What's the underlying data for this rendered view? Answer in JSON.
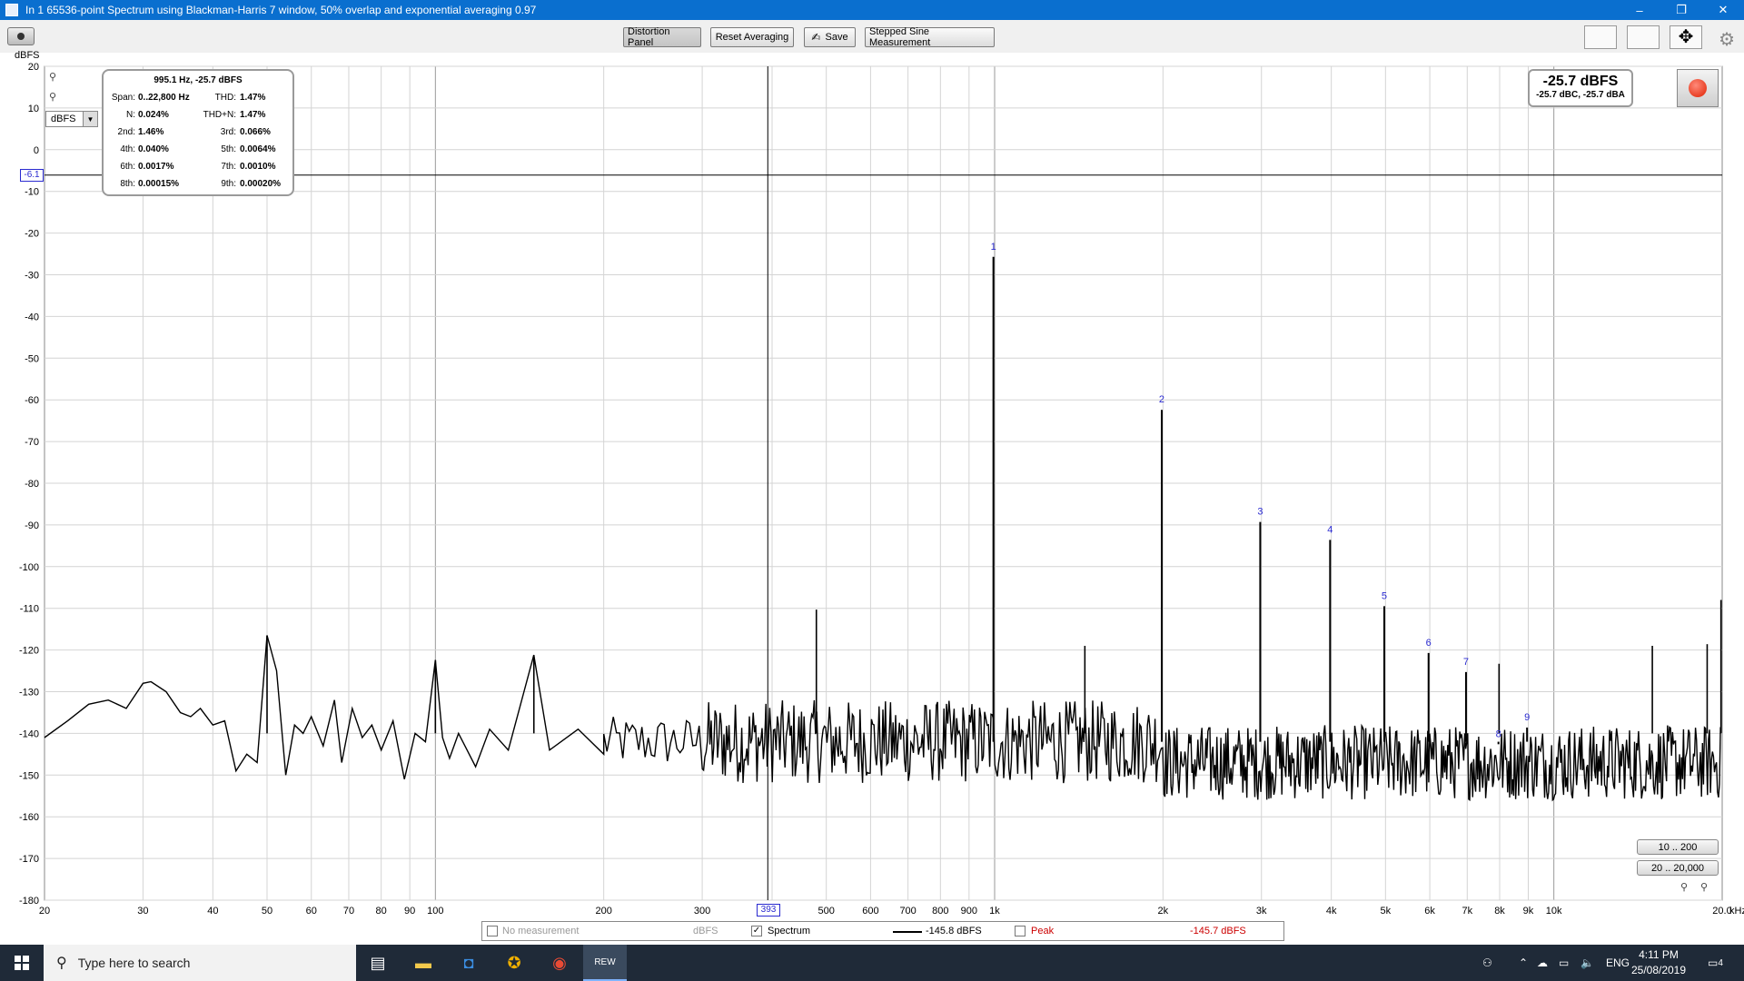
{
  "window": {
    "title": "In 1 65536-point Spectrum using Blackman-Harris 7 window, 50% overlap and exponential averaging 0.97",
    "minimize": "–",
    "restore": "❐",
    "close": "✕"
  },
  "toolbar": {
    "distortion_panel": "Distortion Panel",
    "reset_averaging": "Reset Averaging",
    "save": "Save",
    "stepped_sine": "Stepped Sine Measurement"
  },
  "distortion_panel": {
    "header": "995.1 Hz, -25.7 dBFS",
    "rows": [
      {
        "l1": "Span:",
        "v1": "0..22,800 Hz",
        "l2": "THD:",
        "v2": "1.47%"
      },
      {
        "l1": "N:",
        "v1": "0.024%",
        "l2": "THD+N:",
        "v2": "1.47%"
      },
      {
        "l1": "2nd:",
        "v1": "1.46%",
        "l2": "3rd:",
        "v2": "0.066%"
      },
      {
        "l1": "4th:",
        "v1": "0.040%",
        "l2": "5th:",
        "v2": "0.0064%"
      },
      {
        "l1": "6th:",
        "v1": "0.0017%",
        "l2": "7th:",
        "v2": "0.0010%"
      },
      {
        "l1": "8th:",
        "v1": "0.00015%",
        "l2": "9th:",
        "v2": "0.00020%"
      }
    ]
  },
  "level_meter": {
    "main": "-25.7 dBFS",
    "sub": "-25.7 dBC, -25.7 dBA"
  },
  "unit_select": {
    "value": "dBFS"
  },
  "range_buttons": {
    "a": "10 .. 200",
    "b": "20 .. 20,000"
  },
  "cursor": {
    "y_value": "-6.1",
    "x_value": "393"
  },
  "legend": {
    "no_measurement": "No measurement",
    "no_measurement_unit": "dBFS",
    "spectrum": "Spectrum",
    "spectrum_value": "-145.8 dBFS",
    "peak": "Peak",
    "peak_value": "-145.7 dBFS",
    "peak_color": "#cc0000"
  },
  "taskbar": {
    "search_placeholder": "Type here to search",
    "lang": "ENG",
    "time": "4:11 PM",
    "date": "25/08/2019",
    "notif_count": "4"
  },
  "chart_data": {
    "type": "line",
    "xscale": "log",
    "xlim": [
      20,
      20000
    ],
    "ylim": [
      -180,
      20
    ],
    "ylabel": "dBFS",
    "x_unit_label": "kHz",
    "yticks": [
      20,
      10,
      0,
      -10,
      -20,
      -30,
      -40,
      -50,
      -60,
      -70,
      -80,
      -90,
      -100,
      -110,
      -120,
      -130,
      -140,
      -150,
      -160,
      -170,
      -180
    ],
    "xticks": [
      {
        "v": 20,
        "label": "20"
      },
      {
        "v": 30,
        "label": "30"
      },
      {
        "v": 40,
        "label": "40"
      },
      {
        "v": 50,
        "label": "50"
      },
      {
        "v": 60,
        "label": "60"
      },
      {
        "v": 70,
        "label": "70"
      },
      {
        "v": 80,
        "label": "80"
      },
      {
        "v": 90,
        "label": "90"
      },
      {
        "v": 100,
        "label": "100"
      },
      {
        "v": 200,
        "label": "200"
      },
      {
        "v": 300,
        "label": "300"
      },
      {
        "v": 500,
        "label": "500"
      },
      {
        "v": 600,
        "label": "600"
      },
      {
        "v": 700,
        "label": "700"
      },
      {
        "v": 800,
        "label": "800"
      },
      {
        "v": 900,
        "label": "900"
      },
      {
        "v": 1000,
        "label": "1k"
      },
      {
        "v": 2000,
        "label": "2k"
      },
      {
        "v": 3000,
        "label": "3k"
      },
      {
        "v": 4000,
        "label": "4k"
      },
      {
        "v": 5000,
        "label": "5k"
      },
      {
        "v": 6000,
        "label": "6k"
      },
      {
        "v": 7000,
        "label": "7k"
      },
      {
        "v": 8000,
        "label": "8k"
      },
      {
        "v": 9000,
        "label": "9k"
      },
      {
        "v": 10000,
        "label": "10k"
      },
      {
        "v": 20000,
        "label": "20.0"
      }
    ],
    "cursor_y_db": -6.1,
    "cursor_x_hz": 393,
    "harmonics": [
      {
        "n": "1",
        "f": 995,
        "db": -25.7
      },
      {
        "n": "2",
        "f": 1990,
        "db": -62.4
      },
      {
        "n": "3",
        "f": 2985,
        "db": -89.3
      },
      {
        "n": "4",
        "f": 3980,
        "db": -93.6
      },
      {
        "n": "5",
        "f": 4975,
        "db": -109.5
      },
      {
        "n": "6",
        "f": 5970,
        "db": -120.7
      },
      {
        "n": "7",
        "f": 6965,
        "db": -125.3
      },
      {
        "n": "8",
        "f": 7960,
        "db": -142.6
      },
      {
        "n": "9",
        "f": 8955,
        "db": -138.6
      }
    ],
    "spurs": [
      {
        "f": 50,
        "db": -116.5
      },
      {
        "f": 100,
        "db": -122.4
      },
      {
        "f": 150,
        "db": -121.2
      },
      {
        "f": 480,
        "db": -110.3
      },
      {
        "f": 1450,
        "db": -119
      },
      {
        "f": 7980,
        "db": -123.3
      },
      {
        "f": 15000,
        "db": -119
      },
      {
        "f": 18800,
        "db": -118.6
      },
      {
        "f": 19900,
        "db": -108
      }
    ],
    "low_freq_curve": [
      [
        20,
        -141
      ],
      [
        22,
        -137
      ],
      [
        24,
        -133
      ],
      [
        26,
        -132
      ],
      [
        28,
        -134
      ],
      [
        30,
        -128
      ],
      [
        31,
        -127.6
      ],
      [
        33,
        -130
      ],
      [
        35,
        -135
      ],
      [
        36.5,
        -136
      ],
      [
        38,
        -134
      ],
      [
        40,
        -138
      ],
      [
        42,
        -137
      ],
      [
        44,
        -149
      ],
      [
        46,
        -145
      ],
      [
        48,
        -147
      ],
      [
        50,
        -116.5
      ],
      [
        52,
        -125
      ],
      [
        54,
        -150
      ],
      [
        56,
        -138
      ],
      [
        58,
        -140
      ],
      [
        60,
        -136
      ],
      [
        63,
        -143
      ],
      [
        66,
        -132
      ],
      [
        68,
        -147
      ],
      [
        71,
        -134
      ],
      [
        74,
        -141
      ],
      [
        77,
        -138
      ],
      [
        80,
        -144
      ],
      [
        84,
        -137
      ],
      [
        88,
        -151
      ],
      [
        92,
        -140
      ],
      [
        96,
        -142
      ],
      [
        100,
        -122.4
      ],
      [
        103,
        -141
      ],
      [
        106,
        -146
      ],
      [
        110,
        -140
      ],
      [
        118,
        -148
      ],
      [
        125,
        -139
      ],
      [
        135,
        -144
      ],
      [
        150,
        -121.2
      ],
      [
        160,
        -144
      ],
      [
        180,
        -139
      ],
      [
        200,
        -145
      ]
    ],
    "noise_floor_db": [
      -143,
      -148
    ],
    "series": [
      {
        "name": "Spectrum",
        "color": "#000000"
      }
    ]
  }
}
